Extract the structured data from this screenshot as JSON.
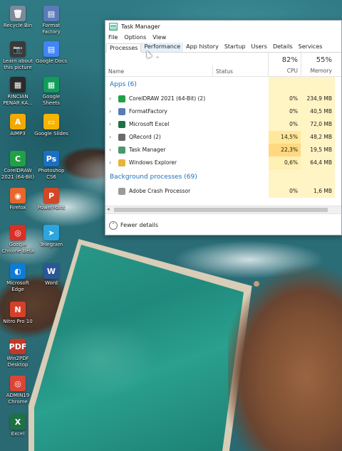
{
  "desktop": {
    "icons": [
      {
        "label": "Recycle Bin",
        "glyph": "🗑",
        "color": "#7a8a99"
      },
      {
        "label": "Format Factory",
        "glyph": "▤",
        "color": "#5b7bb8"
      },
      {
        "label": "Learn about this picture",
        "glyph": "📷",
        "color": "#3a3a3a"
      },
      {
        "label": "Google Docs",
        "glyph": "▤",
        "color": "#4285f4"
      },
      {
        "label": "RINCIAN PENAR KA...",
        "glyph": "▦",
        "color": "#2b2b2b"
      },
      {
        "label": "Google Sheets",
        "glyph": "▦",
        "color": "#0f9d58"
      },
      {
        "label": "AIMP3",
        "glyph": "A",
        "color": "#f2a900"
      },
      {
        "label": "Google Slides",
        "glyph": "▭",
        "color": "#f4b400"
      },
      {
        "label": "CorelDRAW 2021 (64-Bit)",
        "glyph": "C",
        "color": "#22a045"
      },
      {
        "label": "Photoshop CS6",
        "glyph": "Ps",
        "color": "#1b6fc4"
      },
      {
        "label": "Firefox",
        "glyph": "◉",
        "color": "#e8662a"
      },
      {
        "label": "PowerPoint",
        "glyph": "P",
        "color": "#d24726"
      },
      {
        "label": "Google Chrome Beta",
        "glyph": "◎",
        "color": "#d93025"
      },
      {
        "label": "Telegram",
        "glyph": "➤",
        "color": "#2ca5e0"
      },
      {
        "label": "Microsoft Edge",
        "glyph": "◐",
        "color": "#0f7bd6"
      },
      {
        "label": "Word",
        "glyph": "W",
        "color": "#2b5797"
      },
      {
        "label": "Nitro Pro 10",
        "glyph": "N",
        "color": "#d5402b"
      },
      {
        "label": "Win2PDF Desktop",
        "glyph": "PDF",
        "color": "#c0392b"
      },
      {
        "label": "ADMIN19 Chrome",
        "glyph": "◎",
        "color": "#db4437"
      },
      {
        "label": "Excel",
        "glyph": "X",
        "color": "#1e7145"
      }
    ]
  },
  "task_manager": {
    "title": "Task Manager",
    "menu": [
      "File",
      "Options",
      "View"
    ],
    "tabs": [
      "Processes",
      "Performance",
      "App history",
      "Startup",
      "Users",
      "Details",
      "Services"
    ],
    "active_tab": "Processes",
    "hovered_tab": "Performance",
    "headers": {
      "name": "Name",
      "status": "Status",
      "cpu_pct": "82%",
      "cpu_label": "CPU",
      "mem_pct": "55%",
      "mem_label": "Memory"
    },
    "apps_group": "Apps (6)",
    "apps": [
      {
        "name": "CorelDRAW 2021 (64-Bit) (2)",
        "cpu": "0%",
        "mem": "234,9 MB",
        "icon_color": "#22a045",
        "heat": "#fff4c4"
      },
      {
        "name": "FormatFactory",
        "cpu": "0%",
        "mem": "40,5 MB",
        "icon_color": "#5b7bb8",
        "heat": "#fff4c4"
      },
      {
        "name": "Microsoft Excel",
        "cpu": "0%",
        "mem": "72,0 MB",
        "icon_color": "#1e7145",
        "heat": "#fff4c4"
      },
      {
        "name": "QRecord (2)",
        "cpu": "14,5%",
        "mem": "48,2 MB",
        "icon_color": "#6a6a6a",
        "heat": "#ffe89a"
      },
      {
        "name": "Task Manager",
        "cpu": "22,3%",
        "mem": "19,5 MB",
        "icon_color": "#4a9a6a",
        "heat": "#ffd880"
      },
      {
        "name": "Windows Explorer",
        "cpu": "0,6%",
        "mem": "64,4 MB",
        "icon_color": "#e8b339",
        "heat": "#fff0b3"
      }
    ],
    "background_group": "Background processes (69)",
    "background": [
      {
        "name": "Adobe Crash Processor",
        "cpu": "0%",
        "mem": "1,6 MB",
        "icon_color": "#9a9a9a",
        "heat": "#fff4c4"
      }
    ],
    "footer": "Fewer details"
  }
}
